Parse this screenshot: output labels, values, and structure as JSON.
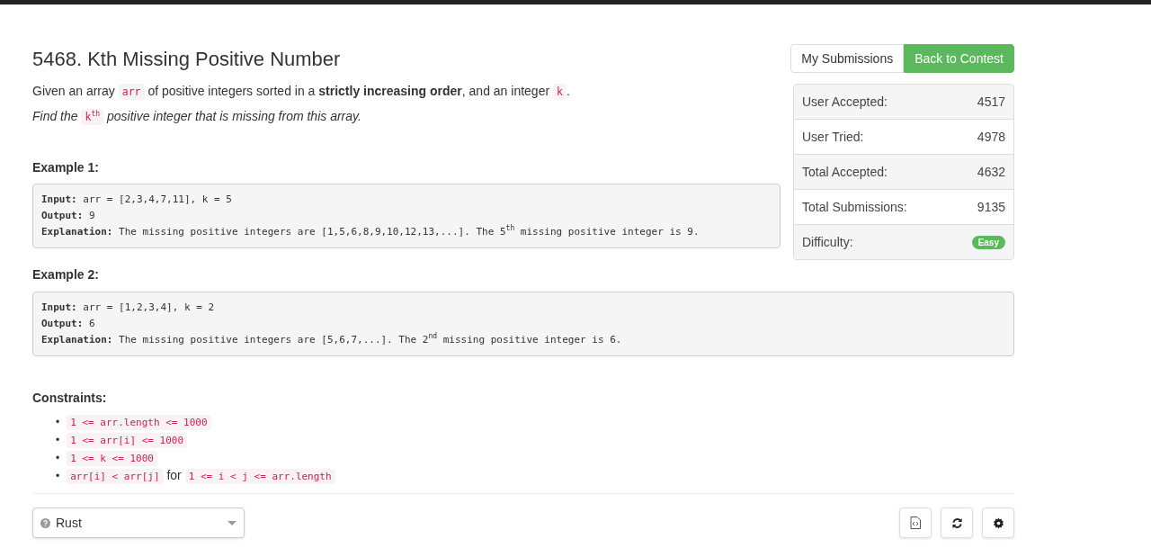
{
  "title": "5468. Kth Missing Positive Number",
  "description": [
    [
      {
        "kind": "text",
        "text": "Given an array "
      },
      {
        "kind": "code",
        "text": "arr"
      },
      {
        "kind": "text",
        "text": " of positive integers sorted in a "
      },
      {
        "kind": "bold",
        "text": "strictly increasing order"
      },
      {
        "kind": "text",
        "text": ", and an integer "
      },
      {
        "kind": "code",
        "text": "k"
      },
      {
        "kind": "text",
        "text": "."
      }
    ],
    [
      {
        "kind": "italic",
        "text": "Find the "
      },
      {
        "kind": "code",
        "text": "k$^{th}$"
      },
      {
        "kind": "italic",
        "text": " positive integer that is missing from this array."
      }
    ]
  ],
  "examples": [
    {
      "heading": "Example 1:",
      "lines": [
        "**Input:** arr = [2,3,4,7,11], k = 5",
        "**Output:** 9",
        "**Explanation:** The missing positive integers are [1,5,6,8,9,10,12,13,...]. The 5$^{th}$ missing positive integer is 9."
      ]
    },
    {
      "heading": "Example 2:",
      "lines": [
        "**Input:** arr = [1,2,3,4], k = 2",
        "**Output:** 6",
        "**Explanation:** The missing positive integers are [5,6,7,...]. The 2$^{nd}$ missing positive integer is 6."
      ]
    }
  ],
  "constraints": {
    "heading": "Constraints:",
    "items": [
      {
        "marker": "•",
        "parts": [
          {
            "kind": "code",
            "text": "1 <= arr.length <= 1000"
          }
        ]
      },
      {
        "marker": "•",
        "parts": [
          {
            "kind": "code",
            "text": "1 <= arr[i] <= 1000"
          }
        ]
      },
      {
        "marker": "•",
        "parts": [
          {
            "kind": "code",
            "text": "1 <= k <= 1000"
          }
        ]
      },
      {
        "marker": "•",
        "parts": [
          {
            "kind": "code",
            "text": "arr[i] < arr[j]"
          },
          {
            "kind": "text",
            "text": " for "
          },
          {
            "kind": "code",
            "text": "1 <= i < j <= arr.length"
          }
        ]
      }
    ]
  },
  "buttons": [
    {
      "label": "My Submissions",
      "primary": false
    },
    {
      "label": "Back to Contest",
      "primary": true
    }
  ],
  "stats": [
    {
      "kind": "value",
      "label": "User Accepted:",
      "value": "4517"
    },
    {
      "kind": "value",
      "label": "User Tried:",
      "value": "4978"
    },
    {
      "kind": "value",
      "label": "Total Accepted:",
      "value": "4632"
    },
    {
      "kind": "value",
      "label": "Total Submissions:",
      "value": "9135"
    },
    {
      "kind": "badge",
      "label": "Difficulty:",
      "value": "Easy",
      "color": "#5cb85c"
    }
  ],
  "language": {
    "value": "Rust"
  },
  "tools": [
    {
      "kind": "file"
    },
    {
      "kind": "reset"
    },
    {
      "kind": "settings"
    }
  ]
}
